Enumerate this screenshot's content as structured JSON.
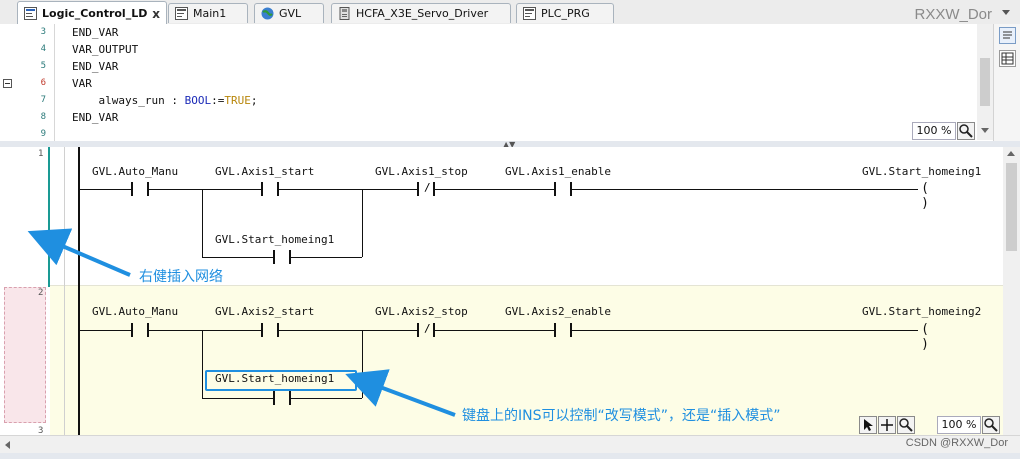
{
  "tabs": [
    {
      "label": "Logic_Control_LD",
      "active": true,
      "icon": "ld-pou-icon"
    },
    {
      "label": "Main1",
      "active": false,
      "icon": "pou-icon"
    },
    {
      "label": "GVL",
      "active": false,
      "icon": "globe-icon"
    },
    {
      "label": "HCFA_X3E_Servo_Driver",
      "active": false,
      "icon": "device-icon"
    },
    {
      "label": "PLC_PRG",
      "active": false,
      "icon": "pou-icon"
    }
  ],
  "tab_close": "x",
  "watermark_top": "RXXW_Dor",
  "declaration": {
    "lines": [
      {
        "num": "3",
        "code": "END_VAR"
      },
      {
        "num": "4",
        "code": "VAR_OUTPUT"
      },
      {
        "num": "5",
        "code": "END_VAR"
      },
      {
        "num": "6",
        "code": "VAR"
      },
      {
        "num": "7",
        "name": "    always_run : ",
        "type": "BOOL",
        "assign": ":=",
        "value": "TRUE",
        "end": ";"
      },
      {
        "num": "8",
        "code": "END_VAR"
      },
      {
        "num": "9",
        "code": ""
      }
    ],
    "zoom": "100 %"
  },
  "ld": {
    "network1": {
      "number": "1",
      "contacts": [
        {
          "var": "GVL.Auto_Manu",
          "negated": false
        },
        {
          "var": "GVL.Axis1_start",
          "negated": false
        },
        {
          "var": "GVL.Start_homeing1",
          "negated": false
        },
        {
          "var": "GVL.Axis1_stop",
          "negated": true
        },
        {
          "var": "GVL.Axis1_enable",
          "negated": false
        }
      ],
      "coil": {
        "var": "GVL.Start_homeing1",
        "symbol": "( )"
      }
    },
    "network2": {
      "number": "2",
      "contacts": [
        {
          "var": "GVL.Auto_Manu",
          "negated": false
        },
        {
          "var": "GVL.Axis2_start",
          "negated": false
        },
        {
          "var": "GVL.Start_homeing1",
          "negated": false
        },
        {
          "var": "GVL.Axis2_stop",
          "negated": true
        },
        {
          "var": "GVL.Axis2_enable",
          "negated": false
        }
      ],
      "coil": {
        "var": "GVL.Start_homeing2",
        "symbol": "( )"
      }
    },
    "network3": {
      "number": "3"
    },
    "negation_symbol": "/",
    "zoom": "100 %"
  },
  "annotations": {
    "insert_network": "右健插入网络",
    "ins_mode": "键盘上的INS可以控制“改写模式”，还是“插入模式”"
  },
  "footer_watermark": "CSDN @RXXW_Dor",
  "colors": {
    "annotation": "#1f8fe0",
    "keyword": "#1c2bb8",
    "value": "#b8860b",
    "network2_bg": "#fdfde6",
    "selected_rail": "#1a9a94"
  }
}
